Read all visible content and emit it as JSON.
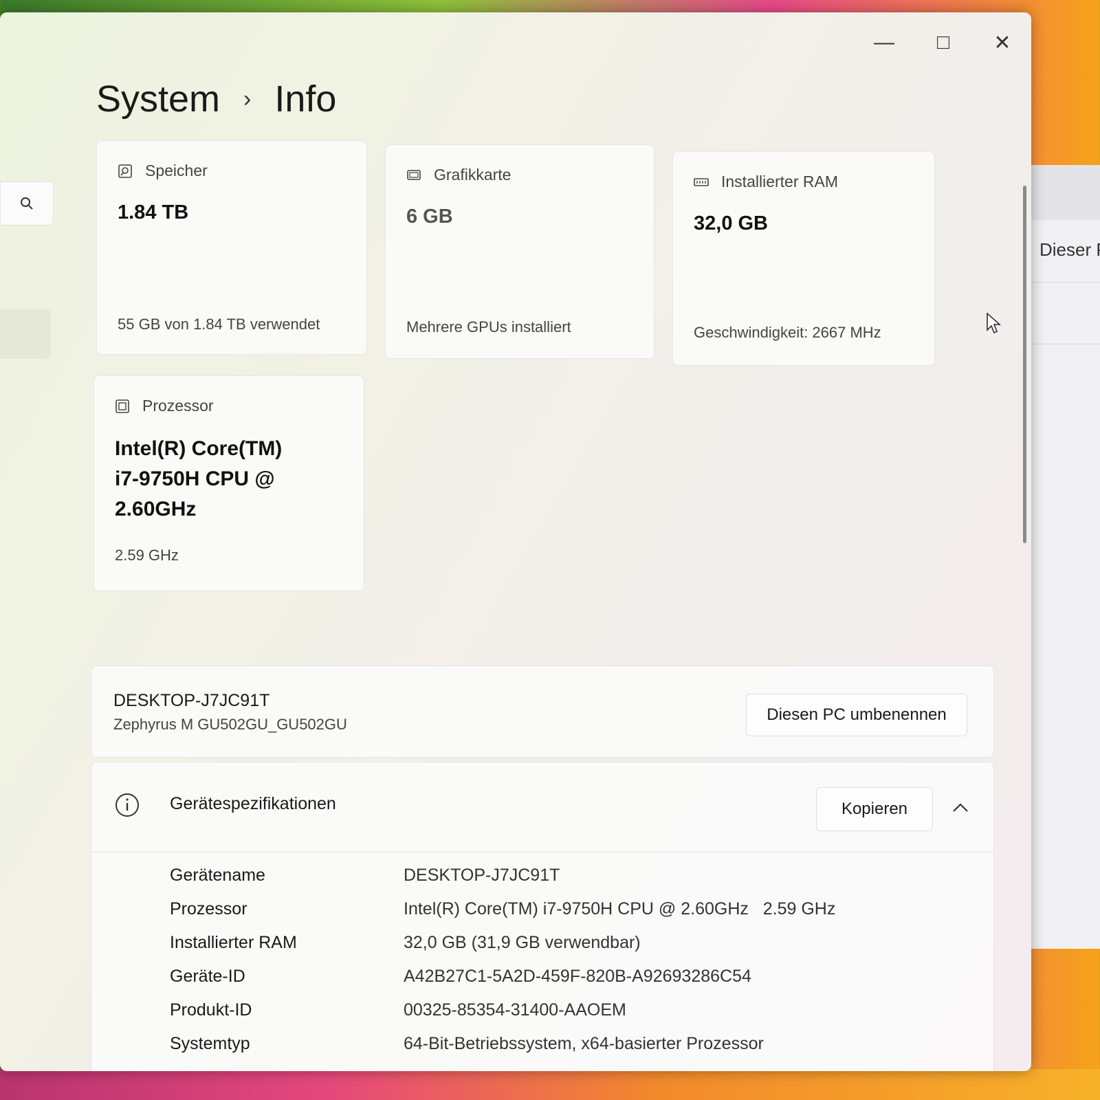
{
  "window": {
    "breadcrumb": {
      "parent": "System",
      "separator": "›",
      "current": "Info"
    },
    "caption": {
      "minimize": "—",
      "maximize": "□",
      "close": "✕"
    }
  },
  "behind_window": {
    "text": "Dieser P"
  },
  "cards": {
    "storage": {
      "label": "Speicher",
      "value": "1.84 TB",
      "sub": "55 GB von 1.84 TB verwendet",
      "icon": "storage-icon"
    },
    "gpu": {
      "label": "Grafikkarte",
      "value": "6 GB",
      "sub": "Mehrere GPUs installiert",
      "icon": "gpu-icon"
    },
    "ram": {
      "label": "Installierter RAM",
      "value": "32,0 GB",
      "sub": "Geschwindigkeit: 2667 MHz",
      "icon": "ram-icon"
    },
    "cpu": {
      "label": "Prozessor",
      "value_lines": [
        "Intel(R) Core(TM)",
        "i7-9750H CPU @",
        "2.60GHz"
      ],
      "sub": "2.59 GHz",
      "icon": "cpu-icon"
    }
  },
  "device": {
    "name": "DESKTOP-J7JC91T",
    "model": "Zephyrus M GU502GU_GU502GU",
    "rename_label": "Diesen PC umbenennen"
  },
  "specs": {
    "title": "Gerätespezifikationen",
    "copy_label": "Kopieren",
    "rows": [
      {
        "key": "Gerätename",
        "value": "DESKTOP-J7JC91T"
      },
      {
        "key": "Prozessor",
        "value": "Intel(R) Core(TM) i7-9750H CPU @ 2.60GHz   2.59 GHz"
      },
      {
        "key": "Installierter RAM",
        "value": "32,0 GB (31,9 GB verwendbar)"
      },
      {
        "key": "Geräte-ID",
        "value": "A42B27C1-5A2D-459F-820B-A92693286C54"
      },
      {
        "key": "Produkt-ID",
        "value": "00325-85354-31400-AAOEM"
      },
      {
        "key": "Systemtyp",
        "value": "64-Bit-Betriebssystem, x64-basierter Prozessor"
      }
    ]
  }
}
